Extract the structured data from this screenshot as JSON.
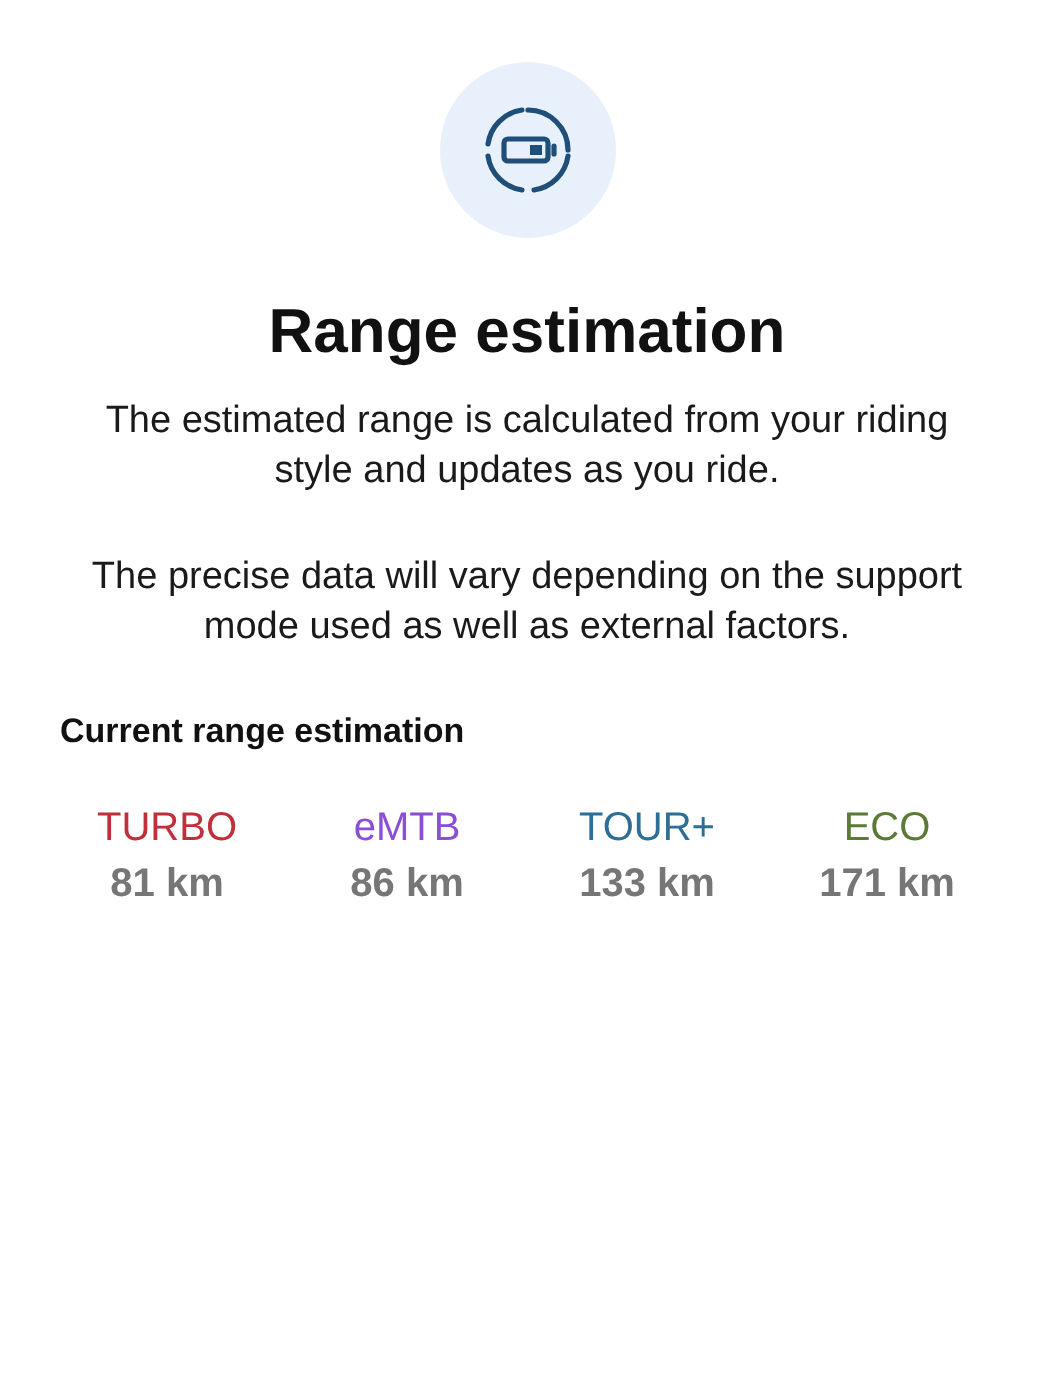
{
  "title": "Range estimation",
  "paragraphs": [
    "The estimated range is calculated from your riding style and updates as you ride.",
    "The precise data will vary depending on the support mode used as well as external factors."
  ],
  "section_label": "Current range estimation",
  "modes": [
    {
      "name": "TURBO",
      "range": "81 km",
      "color": "#c0303a"
    },
    {
      "name": "eMTB",
      "range": "86 km",
      "color": "#8a4fd6"
    },
    {
      "name": "TOUR+",
      "range": "133 km",
      "color": "#2e6f98"
    },
    {
      "name": "ECO",
      "range": "171 km",
      "color": "#5a7a35"
    }
  ]
}
